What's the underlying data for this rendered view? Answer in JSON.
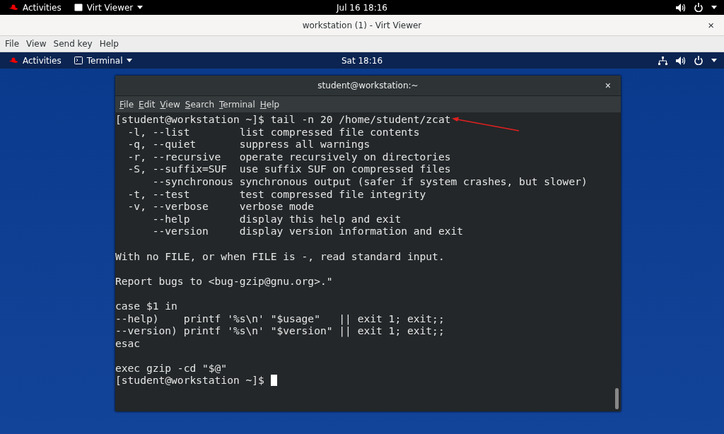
{
  "host_bar": {
    "activities": "Activities",
    "app": "Virt Viewer",
    "clock": "Jul 16  18:16"
  },
  "window": {
    "title": "workstation (1) - Virt Viewer",
    "close": "×",
    "menu": [
      "File",
      "View",
      "Send key",
      "Help"
    ]
  },
  "guest_bar": {
    "activities": "Activities",
    "app": "Terminal",
    "clock": "Sat 18:16"
  },
  "terminal": {
    "title": "student@workstation:~",
    "close": "×",
    "menu": [
      "File",
      "Edit",
      "View",
      "Search",
      "Terminal",
      "Help"
    ],
    "blocks": [
      [
        "[student@workstation ~]$ tail -n 20 /home/student/zcat",
        "  -l, --list        list compressed file contents",
        "  -q, --quiet       suppress all warnings",
        "  -r, --recursive   operate recursively on directories",
        "  -S, --suffix=SUF  use suffix SUF on compressed files",
        "      --synchronous synchronous output (safer if system crashes, but slower)",
        "  -t, --test        test compressed file integrity",
        "  -v, --verbose     verbose mode",
        "      --help        display this help and exit",
        "      --version     display version information and exit"
      ],
      [
        "With no FILE, or when FILE is -, read standard input."
      ],
      [
        "Report bugs to <bug-gzip@gnu.org>.\""
      ],
      [
        "case $1 in",
        "--help)    printf '%s\\n' \"$usage\"   || exit 1; exit;;",
        "--version) printf '%s\\n' \"$version\" || exit 1; exit;;",
        "esac"
      ],
      [
        "exec gzip -cd \"$@\"",
        "[student@workstation ~]$ "
      ]
    ],
    "cursor": true
  }
}
